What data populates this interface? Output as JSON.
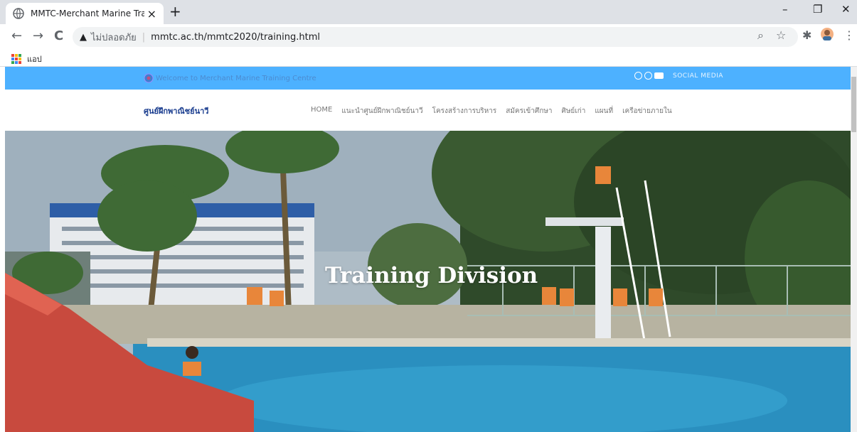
{
  "browser": {
    "tab_title": "MMTC-Merchant Marine Training",
    "tab_close": "×",
    "new_tab": "+",
    "window_minimize": "–",
    "window_restore": "❐",
    "window_close": "✕",
    "back": "←",
    "forward": "→",
    "reload": "C",
    "security_label": "ไม่ปลอดภัย",
    "url": "mmtc.ac.th/mmtc2020/training.html",
    "bookmarks_apps_label": "แอป"
  },
  "site": {
    "topbar": {
      "welcome_text": "Welcome to Merchant Marine Training Centre",
      "social_label": "SOCIAL MEDIA"
    },
    "brand": "ศูนย์ฝึกพาณิชย์นาวี",
    "menu": [
      "HOME",
      "แนะนำศูนย์ฝึกพาณิชย์นาวี",
      "โครงสร้างการบริหาร",
      "สมัครเข้าศึกษา",
      "ศิษย์เก่า",
      "แผนที่",
      "เครือข่ายภายใน"
    ],
    "hero_title": "Training Division"
  },
  "icons": {
    "globe": "globe-icon",
    "warning": "warning-icon",
    "zoom": "zoom-icon",
    "star": "star-icon",
    "extensions": "puzzle-icon",
    "profile": "avatar-icon",
    "menu": "kebab-menu-icon",
    "apps": "apps-grid-icon"
  },
  "colors": {
    "topbar": "#4db1ff",
    "brand": "#1a3d8f",
    "apps_grid": [
      "#ea4335",
      "#fbbc05",
      "#34a853",
      "#4285f4",
      "#ea4335",
      "#fbbc05",
      "#34a853",
      "#4285f4",
      "#ea4335"
    ]
  }
}
